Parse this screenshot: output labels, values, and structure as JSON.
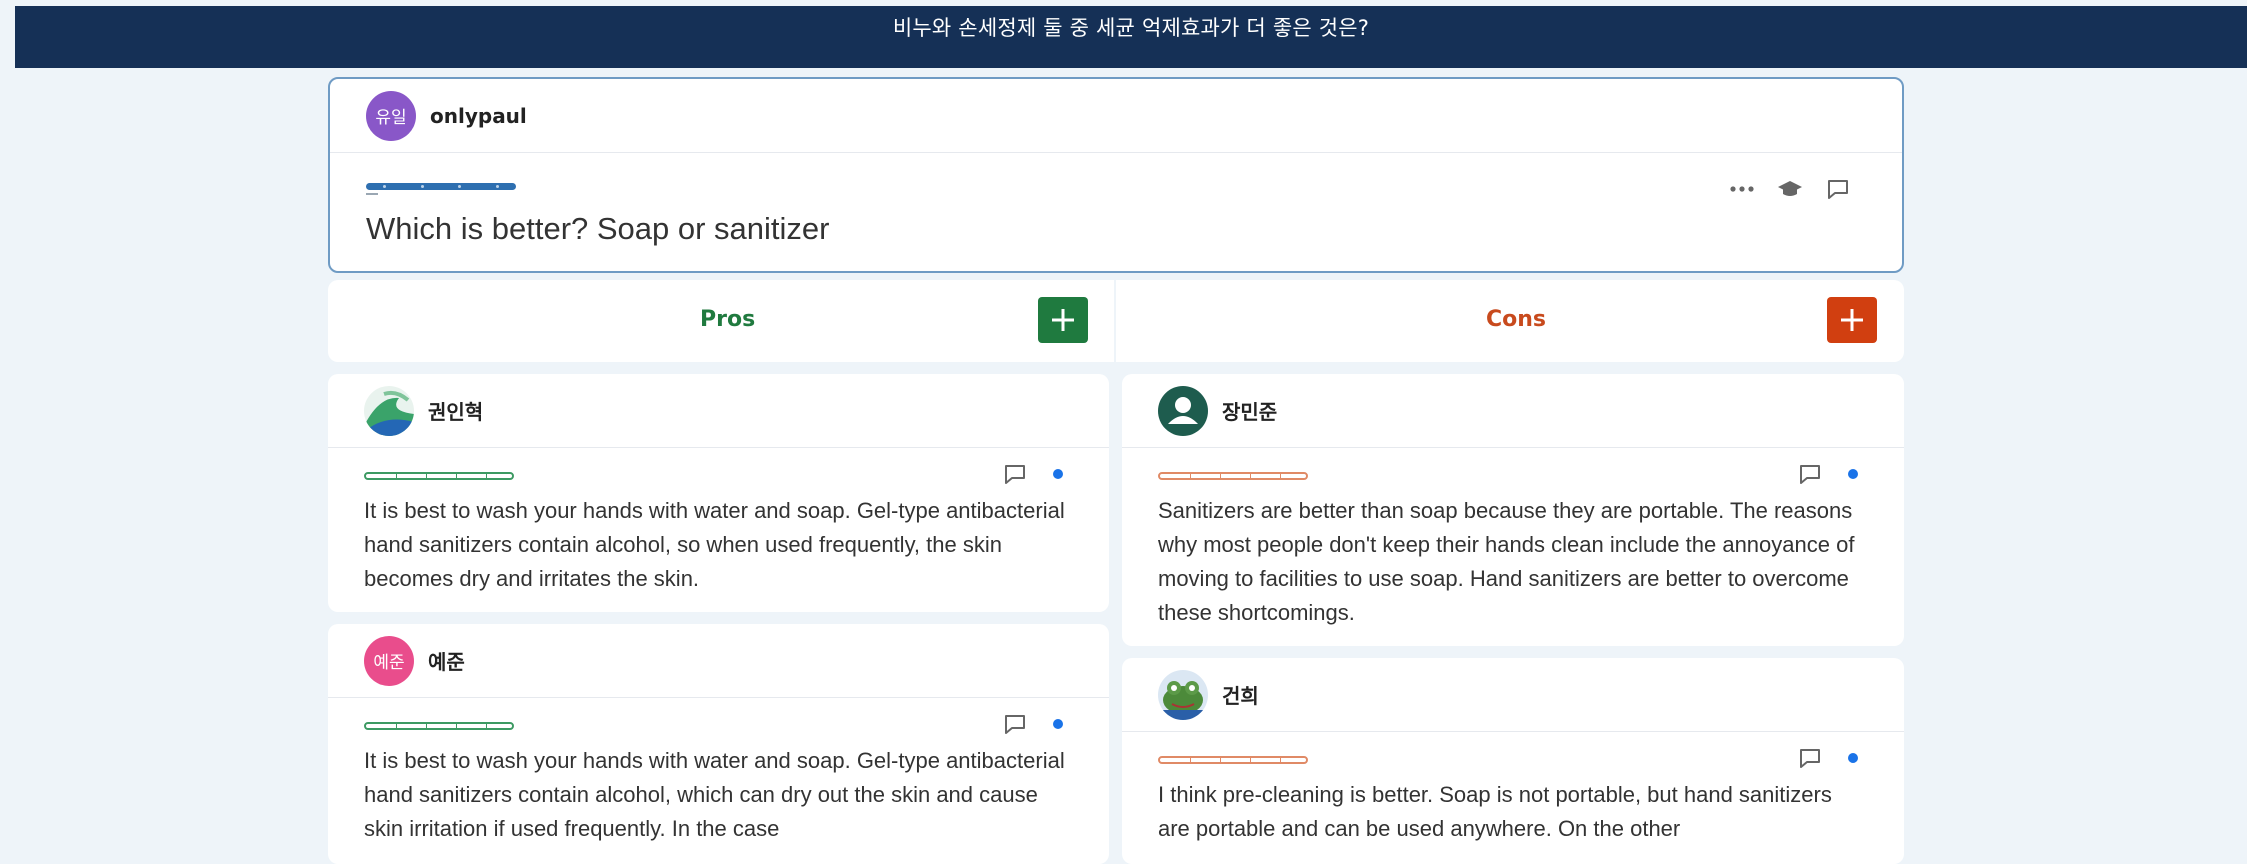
{
  "header": {
    "title": "비누와 손세정제 둘 중 세균 억제효과가 더 좋은 것은?"
  },
  "question": {
    "author_avatar_text": "유일",
    "author": "onlypaul",
    "text": "Which is better? Soap or sanitizer",
    "icons": [
      "more-icon",
      "graduation-cap-icon",
      "comment-icon"
    ]
  },
  "pros": {
    "title": "Pros",
    "add_icon": "plus-icon",
    "color": "#1f7a3f",
    "posts": [
      {
        "author": "권인혁",
        "avatar": "landscape-avatar",
        "text": "It is best to wash your hands with water and soap. Gel-type antibacterial hand sanitizers contain alcohol, so when used frequently, the skin becomes dry and irritates the skin."
      },
      {
        "author": "예준",
        "avatar_text": "예준",
        "text": "It is best to wash your hands with water and soap. Gel-type antibacterial hand sanitizers contain alcohol, which can dry out the skin and cause skin irritation if used frequently. In the case"
      }
    ]
  },
  "cons": {
    "title": "Cons",
    "add_icon": "plus-icon",
    "color": "#d13f10",
    "posts": [
      {
        "author": "장민준",
        "avatar": "default-user-avatar",
        "text": "Sanitizers are better than soap because they are portable. The reasons why most people don't keep their hands clean include the annoyance of moving to facilities to use soap. Hand sanitizers are better to overcome these shortcomings."
      },
      {
        "author": "건희",
        "avatar": "frog-avatar",
        "text": "I think pre-cleaning is better. Soap is not portable, but hand sanitizers are portable and can be used anywhere. On the other"
      }
    ]
  },
  "colors": {
    "header_bg": "#153056",
    "page_bg": "#eef4f9",
    "accent_blue": "#1a73e8"
  }
}
